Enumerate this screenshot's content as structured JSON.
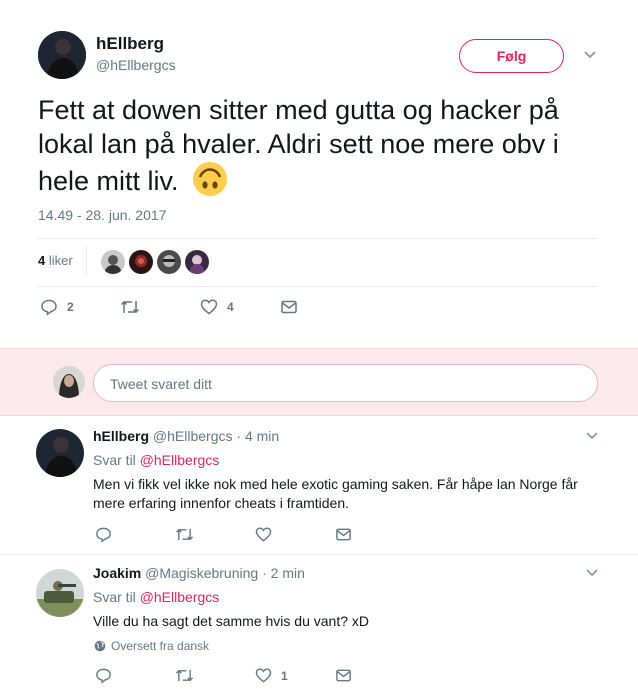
{
  "tweet": {
    "author_name": "hEllberg",
    "author_handle": "@hEllbergcs",
    "follow_label": "Følg",
    "text": "Fett at dowen sitter med gutta og hacker på lokal lan på hvaler. Aldri sett noe mere obv i hele mitt liv.",
    "emoji": "🙃",
    "timestamp": "14.49 - 28. jun. 2017",
    "likes_count": "4",
    "likes_label": "liker",
    "reply_count": "2",
    "retweet_count": "",
    "like_count": "4"
  },
  "compose": {
    "placeholder": "Tweet svaret ditt"
  },
  "replies": [
    {
      "author_name": "hEllberg",
      "author_handle": "@hEllbergcs",
      "time": "4 min",
      "reply_to_label": "Svar til",
      "reply_to_handle": "@hEllbergcs",
      "text": "Men vi fikk vel ikke nok med hele exotic gaming saken. Får håpe lan Norge får mere erfaring innenfor cheats i framtiden.",
      "like_count": ""
    },
    {
      "author_name": "Joakim",
      "author_handle": "@Magiskebruning",
      "time": "2 min",
      "reply_to_label": "Svar til",
      "reply_to_handle": "@hEllbergcs",
      "text": "Ville du ha sagt det samme hvis du vant? xD",
      "translate_label": "Oversett fra dansk",
      "like_count": "1"
    }
  ],
  "separator": "·",
  "colors": {
    "accent": "#e0245e",
    "compose_bg": "#fbe9ee",
    "text_secondary": "#657786",
    "divider": "#e6ecf0"
  },
  "icons": [
    "chevron-down-icon",
    "reply-icon",
    "retweet-icon",
    "heart-icon",
    "message-icon",
    "globe-icon"
  ]
}
